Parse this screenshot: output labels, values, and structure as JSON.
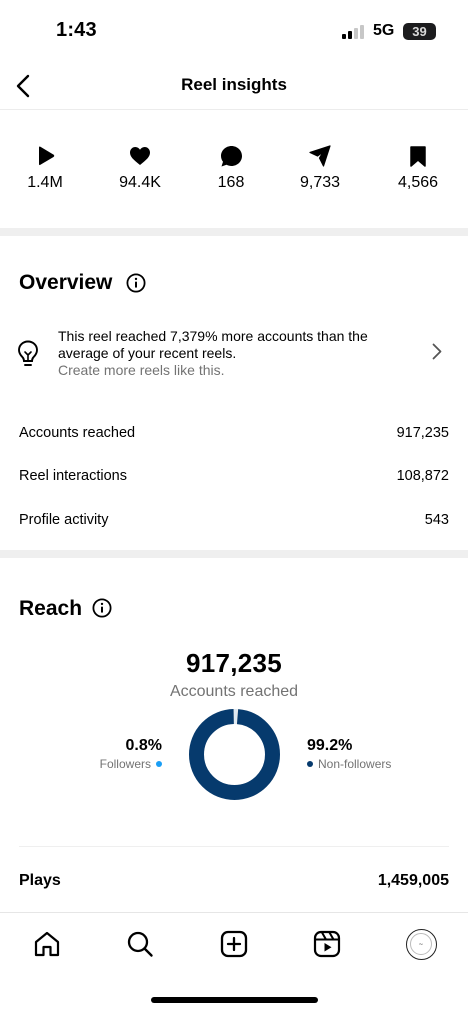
{
  "status_bar": {
    "time": "1:43",
    "network": "5G",
    "battery": "39"
  },
  "header": {
    "title": "Reel insights",
    "back_icon": "chevron-left-icon"
  },
  "stats": [
    {
      "icon": "play-icon",
      "value": "1.4M"
    },
    {
      "icon": "heart-icon",
      "value": "94.4K"
    },
    {
      "icon": "comment-icon",
      "value": "168"
    },
    {
      "icon": "share-icon",
      "value": "9,733"
    },
    {
      "icon": "bookmark-icon",
      "value": "4,566"
    }
  ],
  "overview": {
    "title": "Overview",
    "insight_text": "This reel reached 7,379% more accounts than the average of your recent reels.",
    "insight_cta": "Create more reels like this.",
    "metrics": [
      {
        "label": "Accounts reached",
        "value": "917,235"
      },
      {
        "label": "Reel interactions",
        "value": "108,872"
      },
      {
        "label": "Profile activity",
        "value": "543"
      }
    ]
  },
  "reach": {
    "title": "Reach",
    "total": "917,235",
    "total_label": "Accounts reached",
    "followers_pct": "0.8%",
    "followers_label": "Followers",
    "followers_fraction": 0.008,
    "non_followers_pct": "99.2%",
    "non_followers_label": "Non-followers",
    "non_followers_fraction": 0.992,
    "colors": {
      "followers": "#1a9ef5",
      "non_followers": "#063a6d"
    }
  },
  "plays": {
    "label": "Plays",
    "value": "1,459,005"
  },
  "tabbar": {
    "items": [
      "home-icon",
      "search-icon",
      "create-icon",
      "reels-icon",
      "profile-avatar"
    ]
  }
}
